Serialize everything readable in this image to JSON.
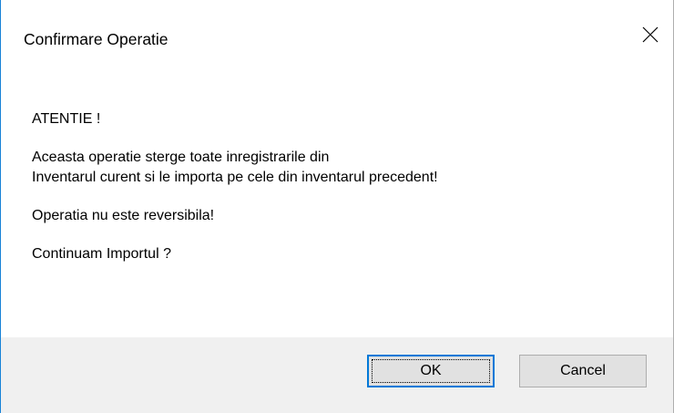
{
  "window": {
    "title": "Confirmare Operatie",
    "close_icon": "close-icon"
  },
  "message": {
    "heading": "ATENTIE !",
    "line1": "Aceasta operatie sterge toate inregistrarile din",
    "line2": "Inventarul curent si le importa pe cele din inventarul precedent!",
    "warning": "Operatia nu este reversibila!",
    "question": "Continuam Importul ?"
  },
  "buttons": {
    "ok_label": "OK",
    "cancel_label": "Cancel"
  },
  "colors": {
    "accent": "#0078d7",
    "footer_bg": "#f0f0f0",
    "button_bg": "#e1e1e1"
  }
}
